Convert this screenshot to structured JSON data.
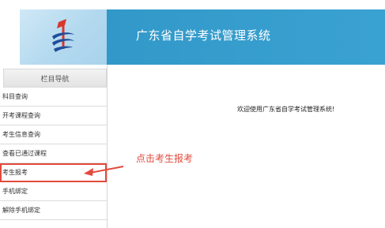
{
  "header": {
    "title": "广东省自学考试管理系统",
    "logo_icon": "exam-logo-icon",
    "background": "#3aa2d2"
  },
  "sidebar": {
    "heading": "栏目导航",
    "items": [
      {
        "label": "科目查询"
      },
      {
        "label": "开考课程查询"
      },
      {
        "label": "考生信息查询"
      },
      {
        "label": "查看已通过课程"
      },
      {
        "label": "考生报考"
      },
      {
        "label": "手机绑定"
      },
      {
        "label": "解除手机绑定"
      }
    ],
    "highlighted_index": 4
  },
  "main": {
    "welcome": "欢迎使用广东省自学考试管理系统!"
  },
  "annotation": {
    "text": "点击考生报考",
    "color": "#e34a3c",
    "arrow_icon": "left-arrow-icon"
  }
}
